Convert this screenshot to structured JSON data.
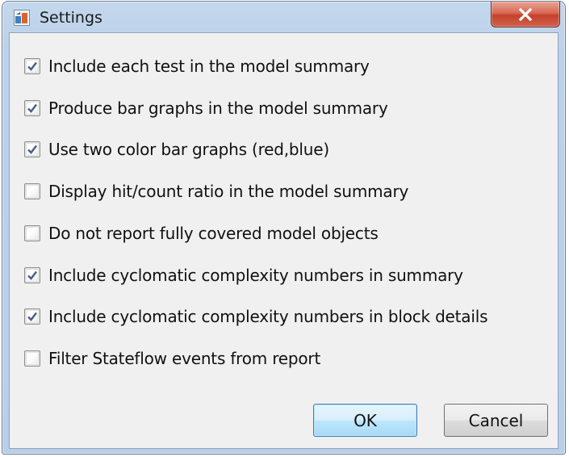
{
  "window": {
    "title": "Settings",
    "close_glyph": "X"
  },
  "options": [
    {
      "label": "Include each test in the model summary",
      "checked": true
    },
    {
      "label": "Produce bar graphs in the model summary",
      "checked": true
    },
    {
      "label": "Use two color bar graphs (red,blue)",
      "checked": true
    },
    {
      "label": "Display hit/count ratio in the model summary",
      "checked": false
    },
    {
      "label": "Do not report fully covered model objects",
      "checked": false
    },
    {
      "label": "Include cyclomatic complexity numbers in summary",
      "checked": true
    },
    {
      "label": "Include cyclomatic complexity numbers in block details",
      "checked": true
    },
    {
      "label": "Filter Stateflow events from report",
      "checked": false
    }
  ],
  "buttons": {
    "ok": "OK",
    "cancel": "Cancel"
  },
  "colors": {
    "checkmark": "#4a5b8c",
    "close_button": "#c9452f",
    "default_button_border": "#3c7fb1"
  }
}
